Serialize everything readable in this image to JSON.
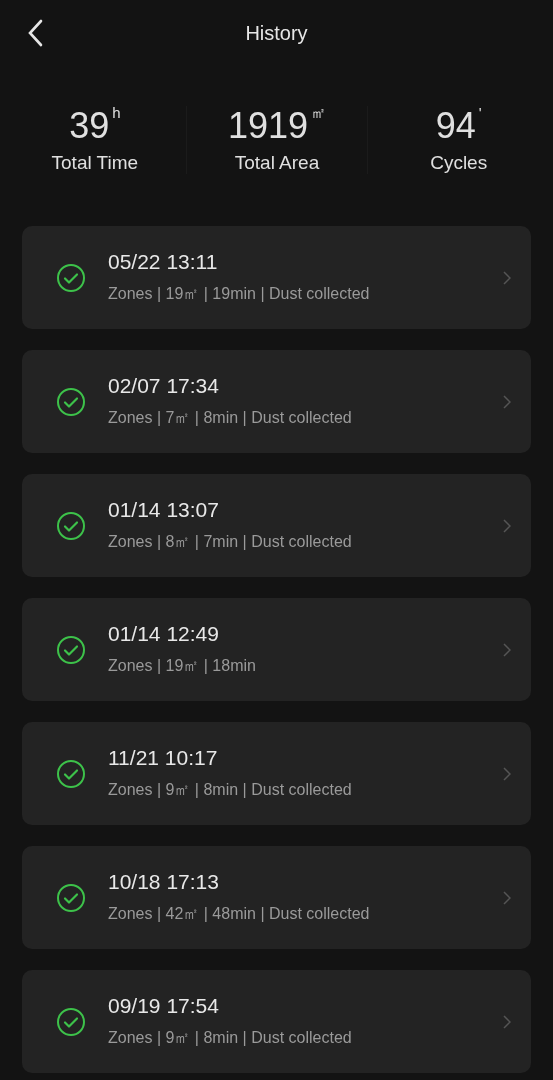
{
  "header": {
    "title": "History"
  },
  "stats": [
    {
      "value": "39",
      "unit": "h",
      "label": "Total Time"
    },
    {
      "value": "1919",
      "unit": "㎡",
      "label": "Total Area"
    },
    {
      "value": "94",
      "unit": "'",
      "label": "Cycles"
    }
  ],
  "records": [
    {
      "time": "05/22 13:11",
      "details": "Zones | 19㎡ | 19min | Dust collected",
      "completed": true
    },
    {
      "time": "02/07 17:34",
      "details": "Zones | 7㎡ | 8min | Dust collected",
      "completed": true
    },
    {
      "time": "01/14 13:07",
      "details": "Zones | 8㎡ | 7min | Dust collected",
      "completed": true
    },
    {
      "time": "01/14 12:49",
      "details": "Zones | 19㎡ | 18min",
      "completed": true
    },
    {
      "time": "11/21 10:17",
      "details": "Zones | 9㎡ | 8min | Dust collected",
      "completed": true
    },
    {
      "time": "10/18 17:13",
      "details": "Zones | 42㎡ | 48min | Dust collected",
      "completed": true
    },
    {
      "time": "09/19 17:54",
      "details": "Zones | 9㎡ | 8min | Dust collected",
      "completed": true
    }
  ]
}
